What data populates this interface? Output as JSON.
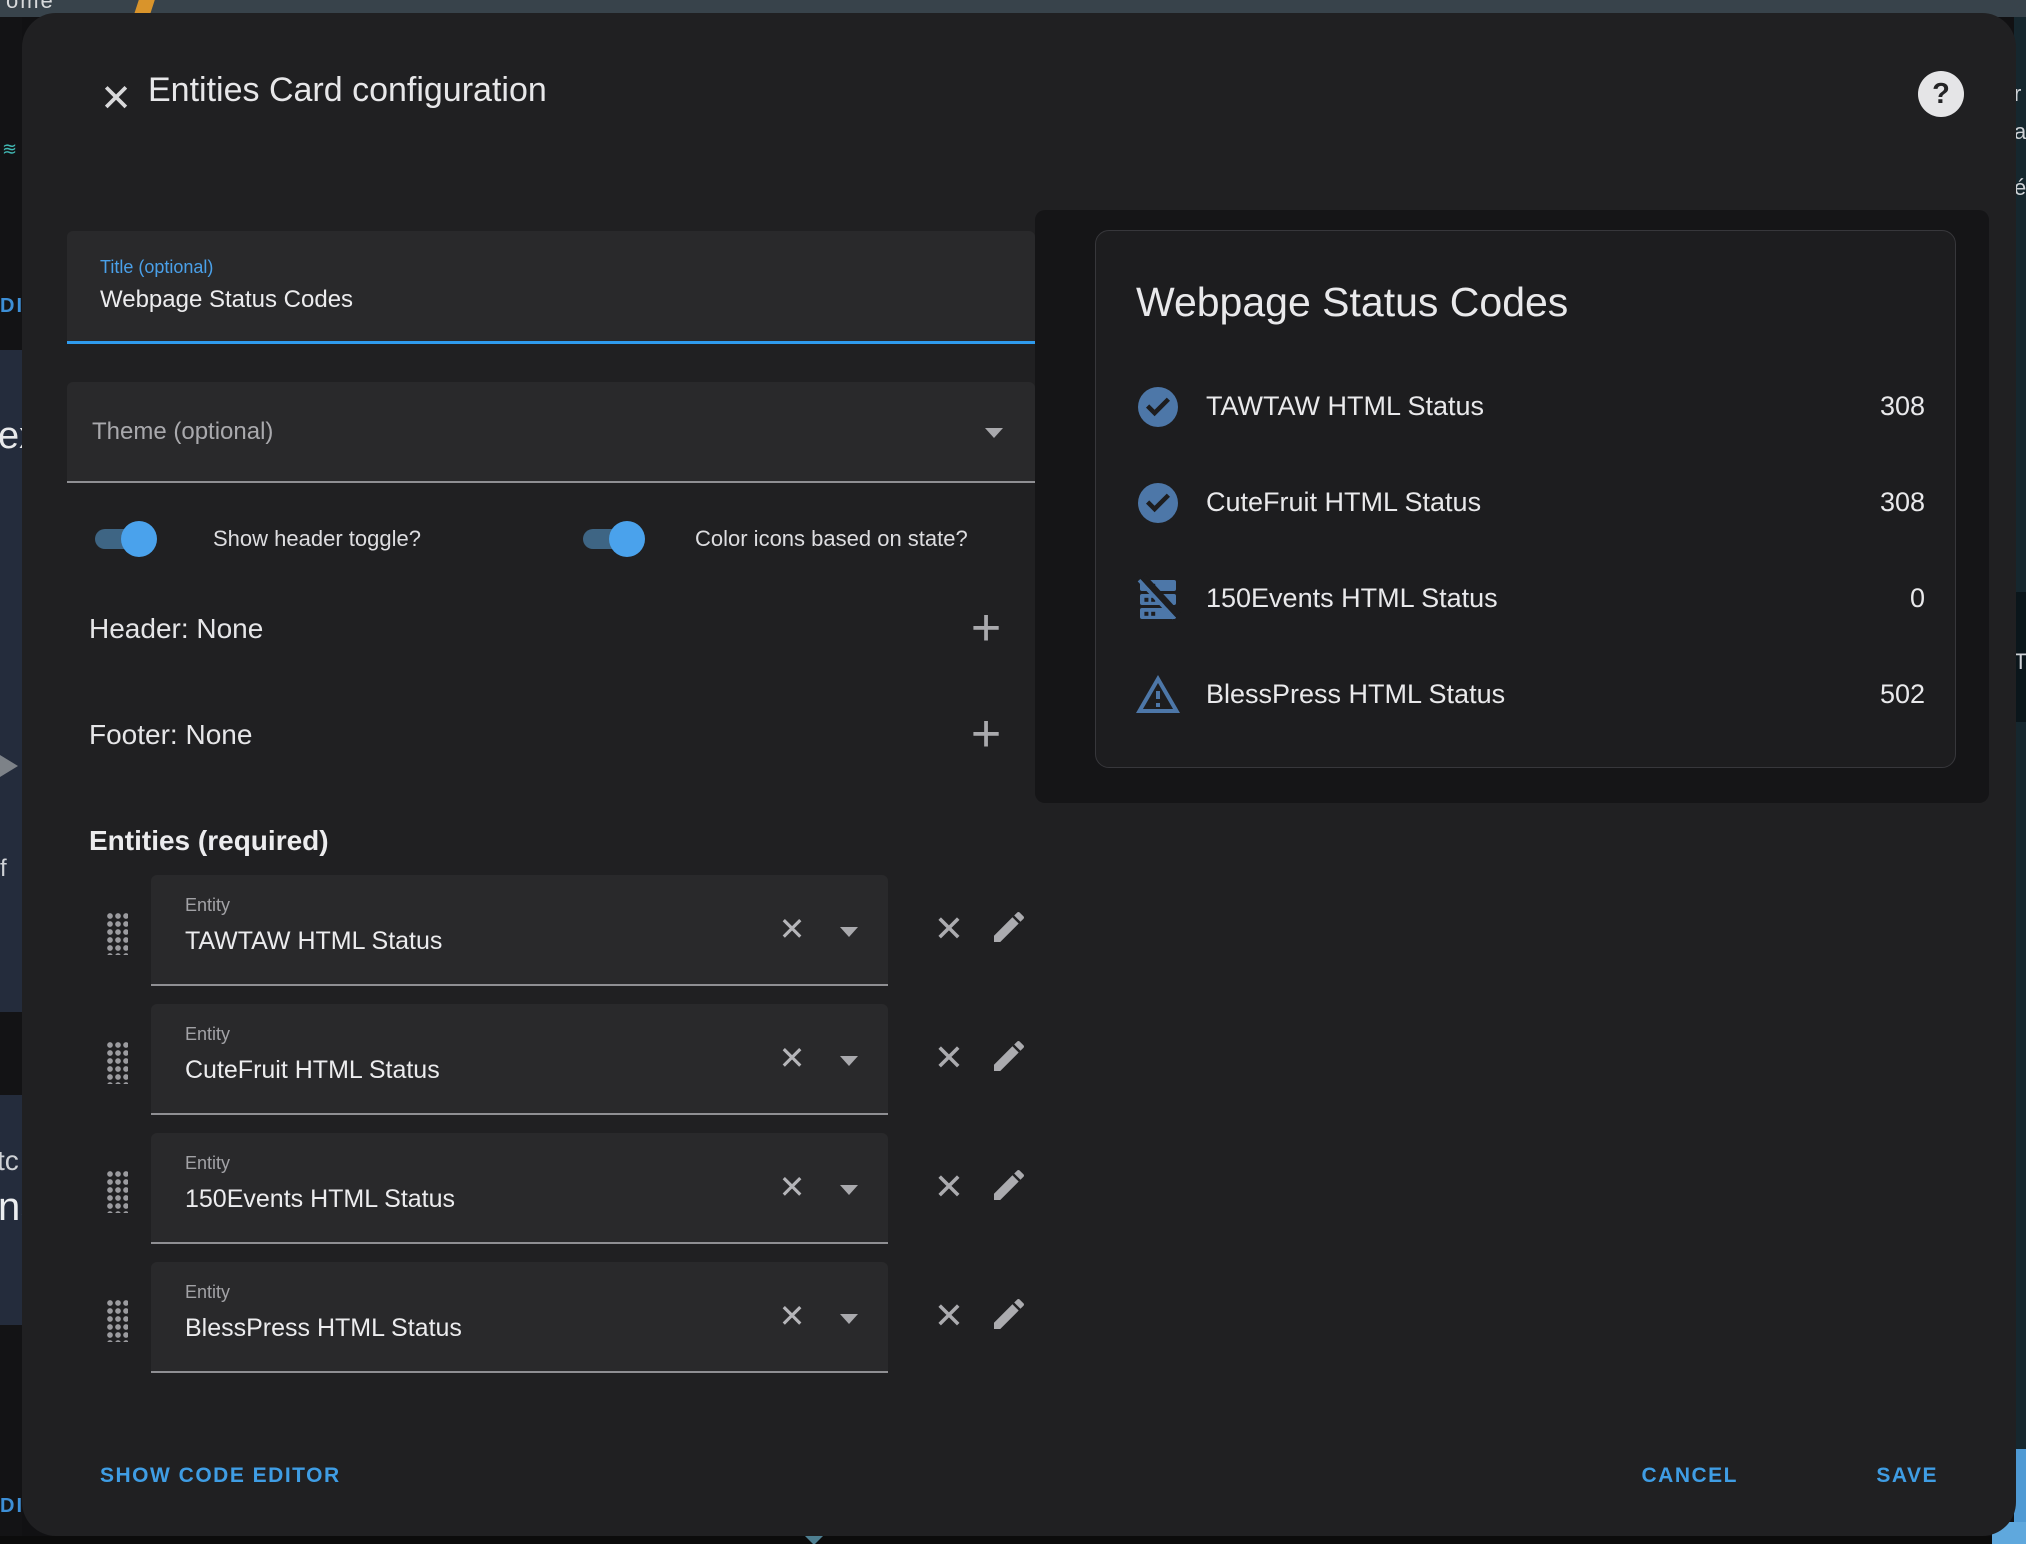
{
  "backdrop": {
    "top_left_text": "ome",
    "left": {
      "teal_glyph": "≋",
      "di_top": "DI",
      "ex": "ex",
      "f": "f",
      "tc": "tc",
      "na": "na",
      "di_bottom": "DI"
    },
    "right": {
      "f1": "r",
      "f2": "a",
      "f3": "é",
      "f4": "T"
    }
  },
  "dialog": {
    "title": "Entities Card configuration",
    "close_glyph": "✕",
    "help_glyph": "?",
    "form": {
      "title_field": {
        "label": "Title (optional)",
        "value": "Webpage Status Codes"
      },
      "theme_field": {
        "label": "Theme (optional)"
      },
      "toggles": [
        {
          "label": "Show header toggle?",
          "on": true
        },
        {
          "label": "Color icons based on state?",
          "on": true
        }
      ],
      "header_row": {
        "label": "Header: None",
        "add_glyph": "+"
      },
      "footer_row": {
        "label": "Footer: None",
        "add_glyph": "+"
      },
      "entities_heading": "Entities (required)",
      "entity_field_label": "Entity",
      "clear_glyph": "✕",
      "delete_glyph": "✕",
      "entities": [
        {
          "name": "TAWTAW HTML Status"
        },
        {
          "name": "CuteFruit HTML Status"
        },
        {
          "name": "150Events HTML Status"
        },
        {
          "name": "BlessPress HTML Status"
        }
      ]
    },
    "actions": {
      "show_code_editor": "SHOW CODE EDITOR",
      "cancel": "CANCEL",
      "save": "SAVE"
    }
  },
  "preview": {
    "card_title": "Webpage Status Codes",
    "rows": [
      {
        "icon": "check-circle",
        "name": "TAWTAW HTML Status",
        "value": "308"
      },
      {
        "icon": "check-circle",
        "name": "CuteFruit HTML Status",
        "value": "308"
      },
      {
        "icon": "server-off",
        "name": "150Events HTML Status",
        "value": "0"
      },
      {
        "icon": "alert-outline",
        "name": "BlessPress HTML Status",
        "value": "502"
      }
    ]
  },
  "colors": {
    "accent_blue": "#2f9bee",
    "label_blue": "#4aa0e9",
    "button_blue": "#3f9de4",
    "state_icon_blue": "#4d77a8",
    "toggle_track": "#3e6584",
    "toggle_thumb": "#4aa2ec",
    "dialog_bg": "#202022",
    "field_bg": "#29292b",
    "card_bg": "#1d1d1f",
    "topbar_bg": "#38434b"
  }
}
